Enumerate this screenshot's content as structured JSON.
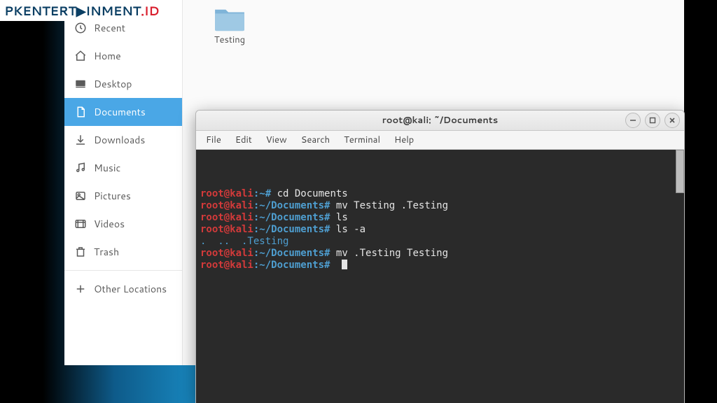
{
  "watermark": {
    "prefix": "PKENTERT",
    "glyph": "▶",
    "suffix": "INMENT",
    "tld": ".ID"
  },
  "sidebar": {
    "items": [
      {
        "icon": "clock-icon",
        "label": "Recent"
      },
      {
        "icon": "home-icon",
        "label": "Home"
      },
      {
        "icon": "desktop-icon",
        "label": "Desktop"
      },
      {
        "icon": "documents-icon",
        "label": "Documents"
      },
      {
        "icon": "download-icon",
        "label": "Downloads"
      },
      {
        "icon": "music-icon",
        "label": "Music"
      },
      {
        "icon": "pictures-icon",
        "label": "Pictures"
      },
      {
        "icon": "videos-icon",
        "label": "Videos"
      },
      {
        "icon": "trash-icon",
        "label": "Trash"
      }
    ],
    "other": {
      "icon": "plus-icon",
      "label": "Other Locations"
    }
  },
  "folder": {
    "name": "Testing"
  },
  "terminal": {
    "title": "root@kali: ~/Documents",
    "menu": [
      "File",
      "Edit",
      "View",
      "Search",
      "Terminal",
      "Help"
    ],
    "lines": [
      {
        "user": "root@kali",
        "path": "~",
        "sep": "#",
        "cmd": "cd Documents"
      },
      {
        "user": "root@kali",
        "path": "~/Documents",
        "sep": "#",
        "cmd": "mv Testing .Testing"
      },
      {
        "user": "root@kali",
        "path": "~/Documents",
        "sep": "#",
        "cmd": "ls"
      },
      {
        "user": "root@kali",
        "path": "~/Documents",
        "sep": "#",
        "cmd": "ls -a"
      },
      {
        "output": ".  ..  .Testing"
      },
      {
        "user": "root@kali",
        "path": "~/Documents",
        "sep": "#",
        "cmd": "mv .Testing Testing"
      },
      {
        "user": "root@kali",
        "path": "~/Documents",
        "sep": "#",
        "cmd": "",
        "cursor": true
      }
    ]
  }
}
